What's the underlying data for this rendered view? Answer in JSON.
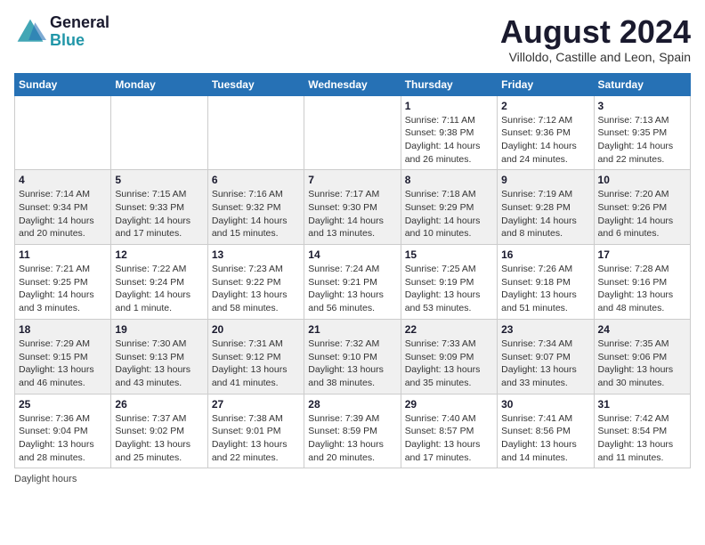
{
  "header": {
    "logo_line1": "General",
    "logo_line2": "Blue",
    "month_title": "August 2024",
    "subtitle": "Villoldo, Castille and Leon, Spain"
  },
  "weekdays": [
    "Sunday",
    "Monday",
    "Tuesday",
    "Wednesday",
    "Thursday",
    "Friday",
    "Saturday"
  ],
  "weeks": [
    [
      {
        "day": "",
        "info": ""
      },
      {
        "day": "",
        "info": ""
      },
      {
        "day": "",
        "info": ""
      },
      {
        "day": "",
        "info": ""
      },
      {
        "day": "1",
        "info": "Sunrise: 7:11 AM\nSunset: 9:38 PM\nDaylight: 14 hours\nand 26 minutes."
      },
      {
        "day": "2",
        "info": "Sunrise: 7:12 AM\nSunset: 9:36 PM\nDaylight: 14 hours\nand 24 minutes."
      },
      {
        "day": "3",
        "info": "Sunrise: 7:13 AM\nSunset: 9:35 PM\nDaylight: 14 hours\nand 22 minutes."
      }
    ],
    [
      {
        "day": "4",
        "info": "Sunrise: 7:14 AM\nSunset: 9:34 PM\nDaylight: 14 hours\nand 20 minutes."
      },
      {
        "day": "5",
        "info": "Sunrise: 7:15 AM\nSunset: 9:33 PM\nDaylight: 14 hours\nand 17 minutes."
      },
      {
        "day": "6",
        "info": "Sunrise: 7:16 AM\nSunset: 9:32 PM\nDaylight: 14 hours\nand 15 minutes."
      },
      {
        "day": "7",
        "info": "Sunrise: 7:17 AM\nSunset: 9:30 PM\nDaylight: 14 hours\nand 13 minutes."
      },
      {
        "day": "8",
        "info": "Sunrise: 7:18 AM\nSunset: 9:29 PM\nDaylight: 14 hours\nand 10 minutes."
      },
      {
        "day": "9",
        "info": "Sunrise: 7:19 AM\nSunset: 9:28 PM\nDaylight: 14 hours\nand 8 minutes."
      },
      {
        "day": "10",
        "info": "Sunrise: 7:20 AM\nSunset: 9:26 PM\nDaylight: 14 hours\nand 6 minutes."
      }
    ],
    [
      {
        "day": "11",
        "info": "Sunrise: 7:21 AM\nSunset: 9:25 PM\nDaylight: 14 hours\nand 3 minutes."
      },
      {
        "day": "12",
        "info": "Sunrise: 7:22 AM\nSunset: 9:24 PM\nDaylight: 14 hours\nand 1 minute."
      },
      {
        "day": "13",
        "info": "Sunrise: 7:23 AM\nSunset: 9:22 PM\nDaylight: 13 hours\nand 58 minutes."
      },
      {
        "day": "14",
        "info": "Sunrise: 7:24 AM\nSunset: 9:21 PM\nDaylight: 13 hours\nand 56 minutes."
      },
      {
        "day": "15",
        "info": "Sunrise: 7:25 AM\nSunset: 9:19 PM\nDaylight: 13 hours\nand 53 minutes."
      },
      {
        "day": "16",
        "info": "Sunrise: 7:26 AM\nSunset: 9:18 PM\nDaylight: 13 hours\nand 51 minutes."
      },
      {
        "day": "17",
        "info": "Sunrise: 7:28 AM\nSunset: 9:16 PM\nDaylight: 13 hours\nand 48 minutes."
      }
    ],
    [
      {
        "day": "18",
        "info": "Sunrise: 7:29 AM\nSunset: 9:15 PM\nDaylight: 13 hours\nand 46 minutes."
      },
      {
        "day": "19",
        "info": "Sunrise: 7:30 AM\nSunset: 9:13 PM\nDaylight: 13 hours\nand 43 minutes."
      },
      {
        "day": "20",
        "info": "Sunrise: 7:31 AM\nSunset: 9:12 PM\nDaylight: 13 hours\nand 41 minutes."
      },
      {
        "day": "21",
        "info": "Sunrise: 7:32 AM\nSunset: 9:10 PM\nDaylight: 13 hours\nand 38 minutes."
      },
      {
        "day": "22",
        "info": "Sunrise: 7:33 AM\nSunset: 9:09 PM\nDaylight: 13 hours\nand 35 minutes."
      },
      {
        "day": "23",
        "info": "Sunrise: 7:34 AM\nSunset: 9:07 PM\nDaylight: 13 hours\nand 33 minutes."
      },
      {
        "day": "24",
        "info": "Sunrise: 7:35 AM\nSunset: 9:06 PM\nDaylight: 13 hours\nand 30 minutes."
      }
    ],
    [
      {
        "day": "25",
        "info": "Sunrise: 7:36 AM\nSunset: 9:04 PM\nDaylight: 13 hours\nand 28 minutes."
      },
      {
        "day": "26",
        "info": "Sunrise: 7:37 AM\nSunset: 9:02 PM\nDaylight: 13 hours\nand 25 minutes."
      },
      {
        "day": "27",
        "info": "Sunrise: 7:38 AM\nSunset: 9:01 PM\nDaylight: 13 hours\nand 22 minutes."
      },
      {
        "day": "28",
        "info": "Sunrise: 7:39 AM\nSunset: 8:59 PM\nDaylight: 13 hours\nand 20 minutes."
      },
      {
        "day": "29",
        "info": "Sunrise: 7:40 AM\nSunset: 8:57 PM\nDaylight: 13 hours\nand 17 minutes."
      },
      {
        "day": "30",
        "info": "Sunrise: 7:41 AM\nSunset: 8:56 PM\nDaylight: 13 hours\nand 14 minutes."
      },
      {
        "day": "31",
        "info": "Sunrise: 7:42 AM\nSunset: 8:54 PM\nDaylight: 13 hours\nand 11 minutes."
      }
    ]
  ],
  "footer": {
    "daylight_label": "Daylight hours"
  }
}
